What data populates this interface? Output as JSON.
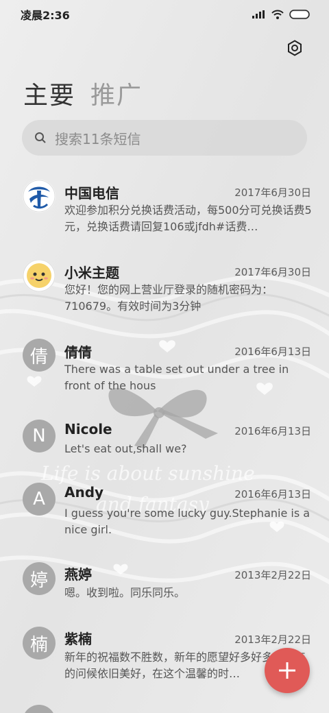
{
  "status_bar": {
    "time": "凌晨2:36"
  },
  "tabs": [
    {
      "label": "主要"
    },
    {
      "label": "推广"
    }
  ],
  "search": {
    "placeholder": "搜索11条短信"
  },
  "conversations": [
    {
      "name": "中国电信",
      "date": "2017年6月30日",
      "preview": "欢迎参加积分兑换话费活动，每500分可兑换话费5元，兑换话费请回复106或jfdh#话费…",
      "avatar": "telecom-logo"
    },
    {
      "name": "小米主题",
      "date": "2017年6月30日",
      "preview": "您好！您的网上营业厅登录的随机密码为：710679。有效时间为3分钟",
      "avatar": "smiley"
    },
    {
      "name": "倩倩",
      "date": "2016年6月13日",
      "preview": "There was a table set out under a tree in front of the hous",
      "avatar_text": "倩"
    },
    {
      "name": "Nicole",
      "date": "2016年6月13日",
      "preview": "Let's eat out,shall we?",
      "avatar_text": "N"
    },
    {
      "name": "Andy",
      "date": "2016年6月13日",
      "preview": "I guess you're some lucky guy.Stephanie is a nice girl.",
      "avatar_text": "A"
    },
    {
      "name": "燕婷",
      "date": "2013年2月22日",
      "preview": "嗯。收到啦。同乐同乐。",
      "avatar_text": "婷"
    },
    {
      "name": "紫楠",
      "date": "2013年2月22日",
      "preview": "新年的祝福数不胜数，新年的愿望好多好多，新年的问候依旧美好，在这个温馨的时…",
      "avatar_text": "楠"
    }
  ],
  "wallpaper_text": {
    "line1": "Life is about sunshine",
    "line2": "and fantasy"
  },
  "colors": {
    "fab": "#e05a57",
    "avatar_gray": "#a9a9a9",
    "telecom_blue": "#1f5aa8"
  }
}
